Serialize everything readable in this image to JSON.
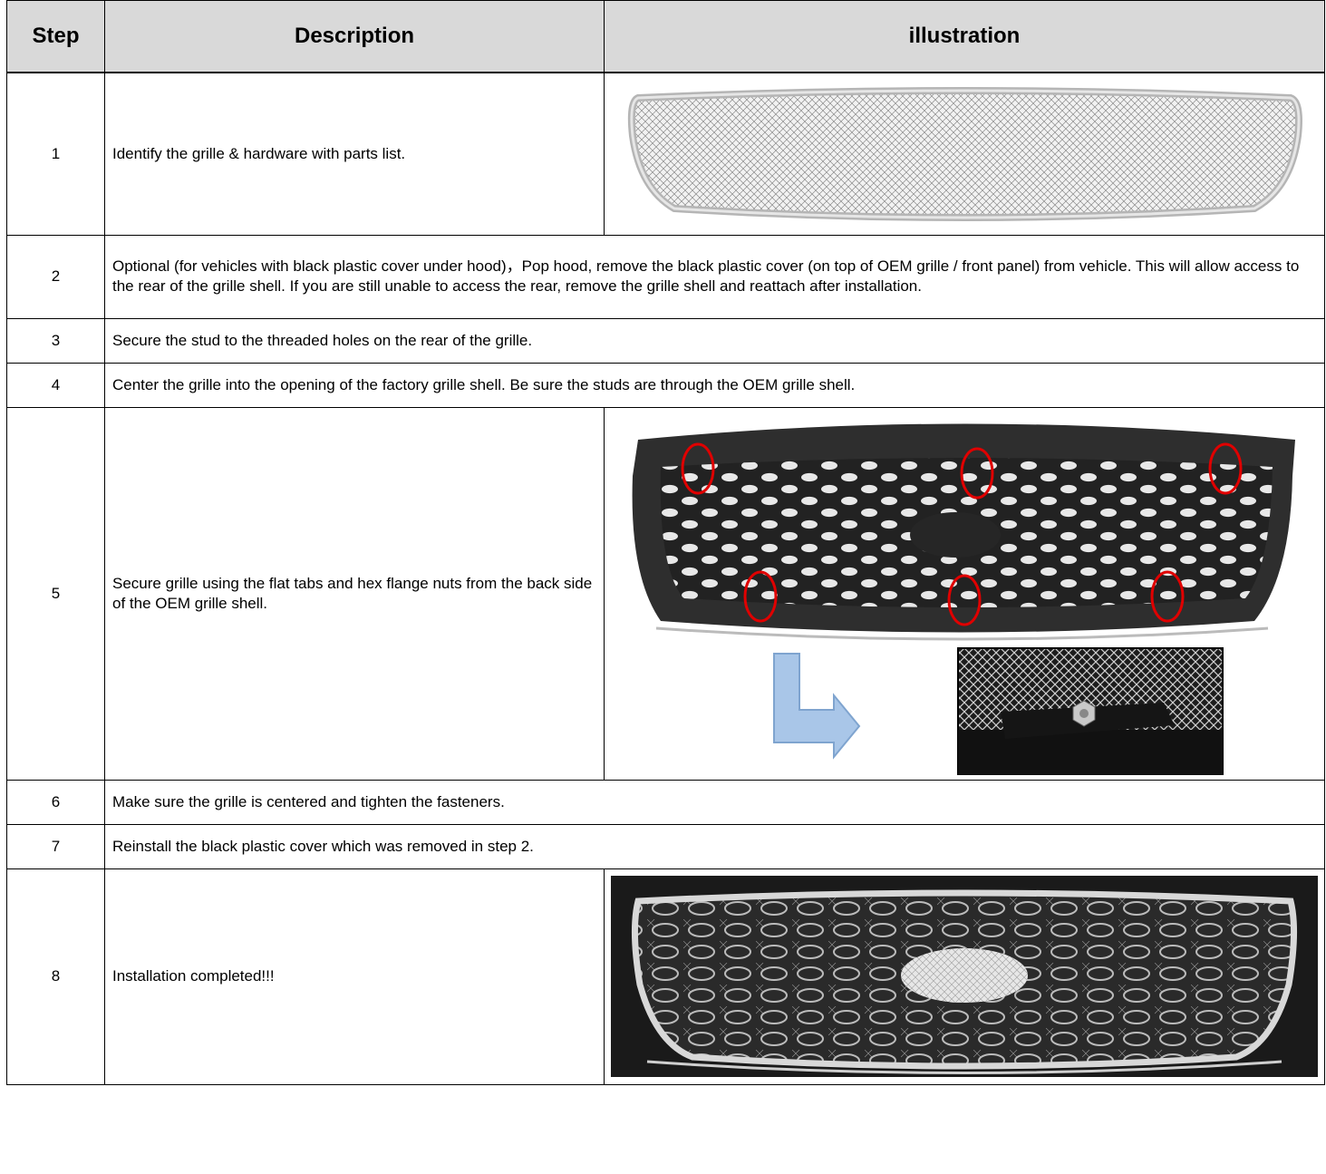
{
  "header": {
    "step": "Step",
    "description": "Description",
    "illustration": "illustration"
  },
  "rows": [
    {
      "num": "1",
      "desc": "Identify the grille & hardware with parts list."
    },
    {
      "num": "2",
      "desc": "Optional (for vehicles with black plastic cover under hood)，Pop hood, remove the black plastic cover (on top of OEM grille / front panel) from vehicle. This will allow access to the rear of the grille shell. If you are still unable to access the rear,  remove the grille shell and reattach after installation."
    },
    {
      "num": "3",
      "desc": "Secure the stud to the threaded holes on the rear of the grille."
    },
    {
      "num": "4",
      "desc": "Center the grille into the opening of the factory grille shell. Be sure the studs are through the OEM grille shell."
    },
    {
      "num": "5",
      "desc": "Secure grille using the flat tabs and hex flange nuts from the back side of the OEM grille shell."
    },
    {
      "num": "6",
      "desc": "Make sure the grille is centered and tighten the fasteners."
    },
    {
      "num": "7",
      "desc": "Reinstall the black plastic cover which was removed in step 2."
    },
    {
      "num": "8",
      "desc": "Installation completed!!!"
    }
  ],
  "images": {
    "step1": "mesh-grille-photo",
    "step5_main": "oem-grille-shell-with-stud-locations-photo",
    "step5_detail": "flat-tab-hex-nut-closeup-photo",
    "step5_arrow": "arrow-icon",
    "step8": "installed-grille-photo"
  },
  "colors": {
    "header_bg": "#d9d9d9",
    "highlight_circle": "#e00000",
    "arrow_fill": "#a9c6e8"
  }
}
